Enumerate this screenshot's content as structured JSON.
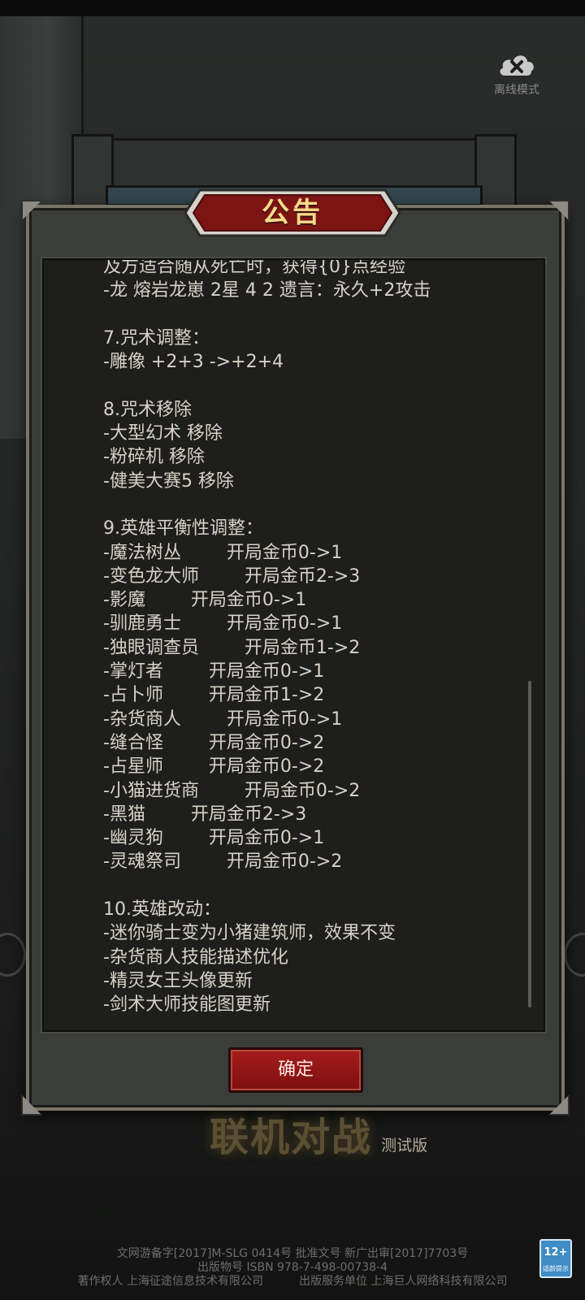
{
  "offline_mode": {
    "label": "离线模式",
    "icon": "cloud-x-icon"
  },
  "dialog": {
    "title": "公告",
    "lines": [
      "及方适合随从死亡时，获得{0}点经验",
      "-龙 熔岩龙崽 2星 4 2 遗言：永久+2攻击",
      "",
      "7.咒术调整：",
      "-雕像 +2+3 ->+2+4",
      "",
      "8.咒术移除",
      "-大型幻术 移除",
      "-粉碎机 移除",
      "-健美大赛5 移除",
      "",
      "9.英雄平衡性调整：",
      "-魔法树丛        开局金币0->1",
      "-变色龙大师        开局金币2->3",
      "-影魔        开局金币0->1",
      "-驯鹿勇士        开局金币0->1",
      "-独眼调查员        开局金币1->2",
      "-掌灯者        开局金币0->1",
      "-占卜师        开局金币1->2",
      "-杂货商人        开局金币0->1",
      "-缝合怪        开局金币0->2",
      "-占星师        开局金币0->2",
      "-小猫进货商        开局金币0->2",
      "-黑猫        开局金币2->3",
      "-幽灵狗        开局金币0->1",
      "-灵魂祭司        开局金币0->2",
      "",
      "10.英雄改动：",
      "-迷你骑士变为小猪建筑师，效果不变",
      "-杂货商人技能描述优化",
      "-精灵女王头像更新",
      "-剑术大师技能图更新"
    ],
    "confirm_label": "确定"
  },
  "game_title": {
    "main": "联机对战",
    "sub": "测试版"
  },
  "footer": {
    "line1": "文网游备字[2017]M-SLG 0414号 批准文号 新广出审[2017]7703号",
    "line2": "出版物号 ISBN 978-7-498-00738-4",
    "copyright": "著作权人 上海征途信息技术有限公司",
    "publisher": "出版服务单位 上海巨人网络科技有限公司"
  },
  "age_rating": {
    "value": "12+",
    "sub": "适龄提示"
  },
  "colors": {
    "title_gold": "#f6d98a",
    "button_red": "#a51c1c",
    "text": "#d6d2c8"
  }
}
